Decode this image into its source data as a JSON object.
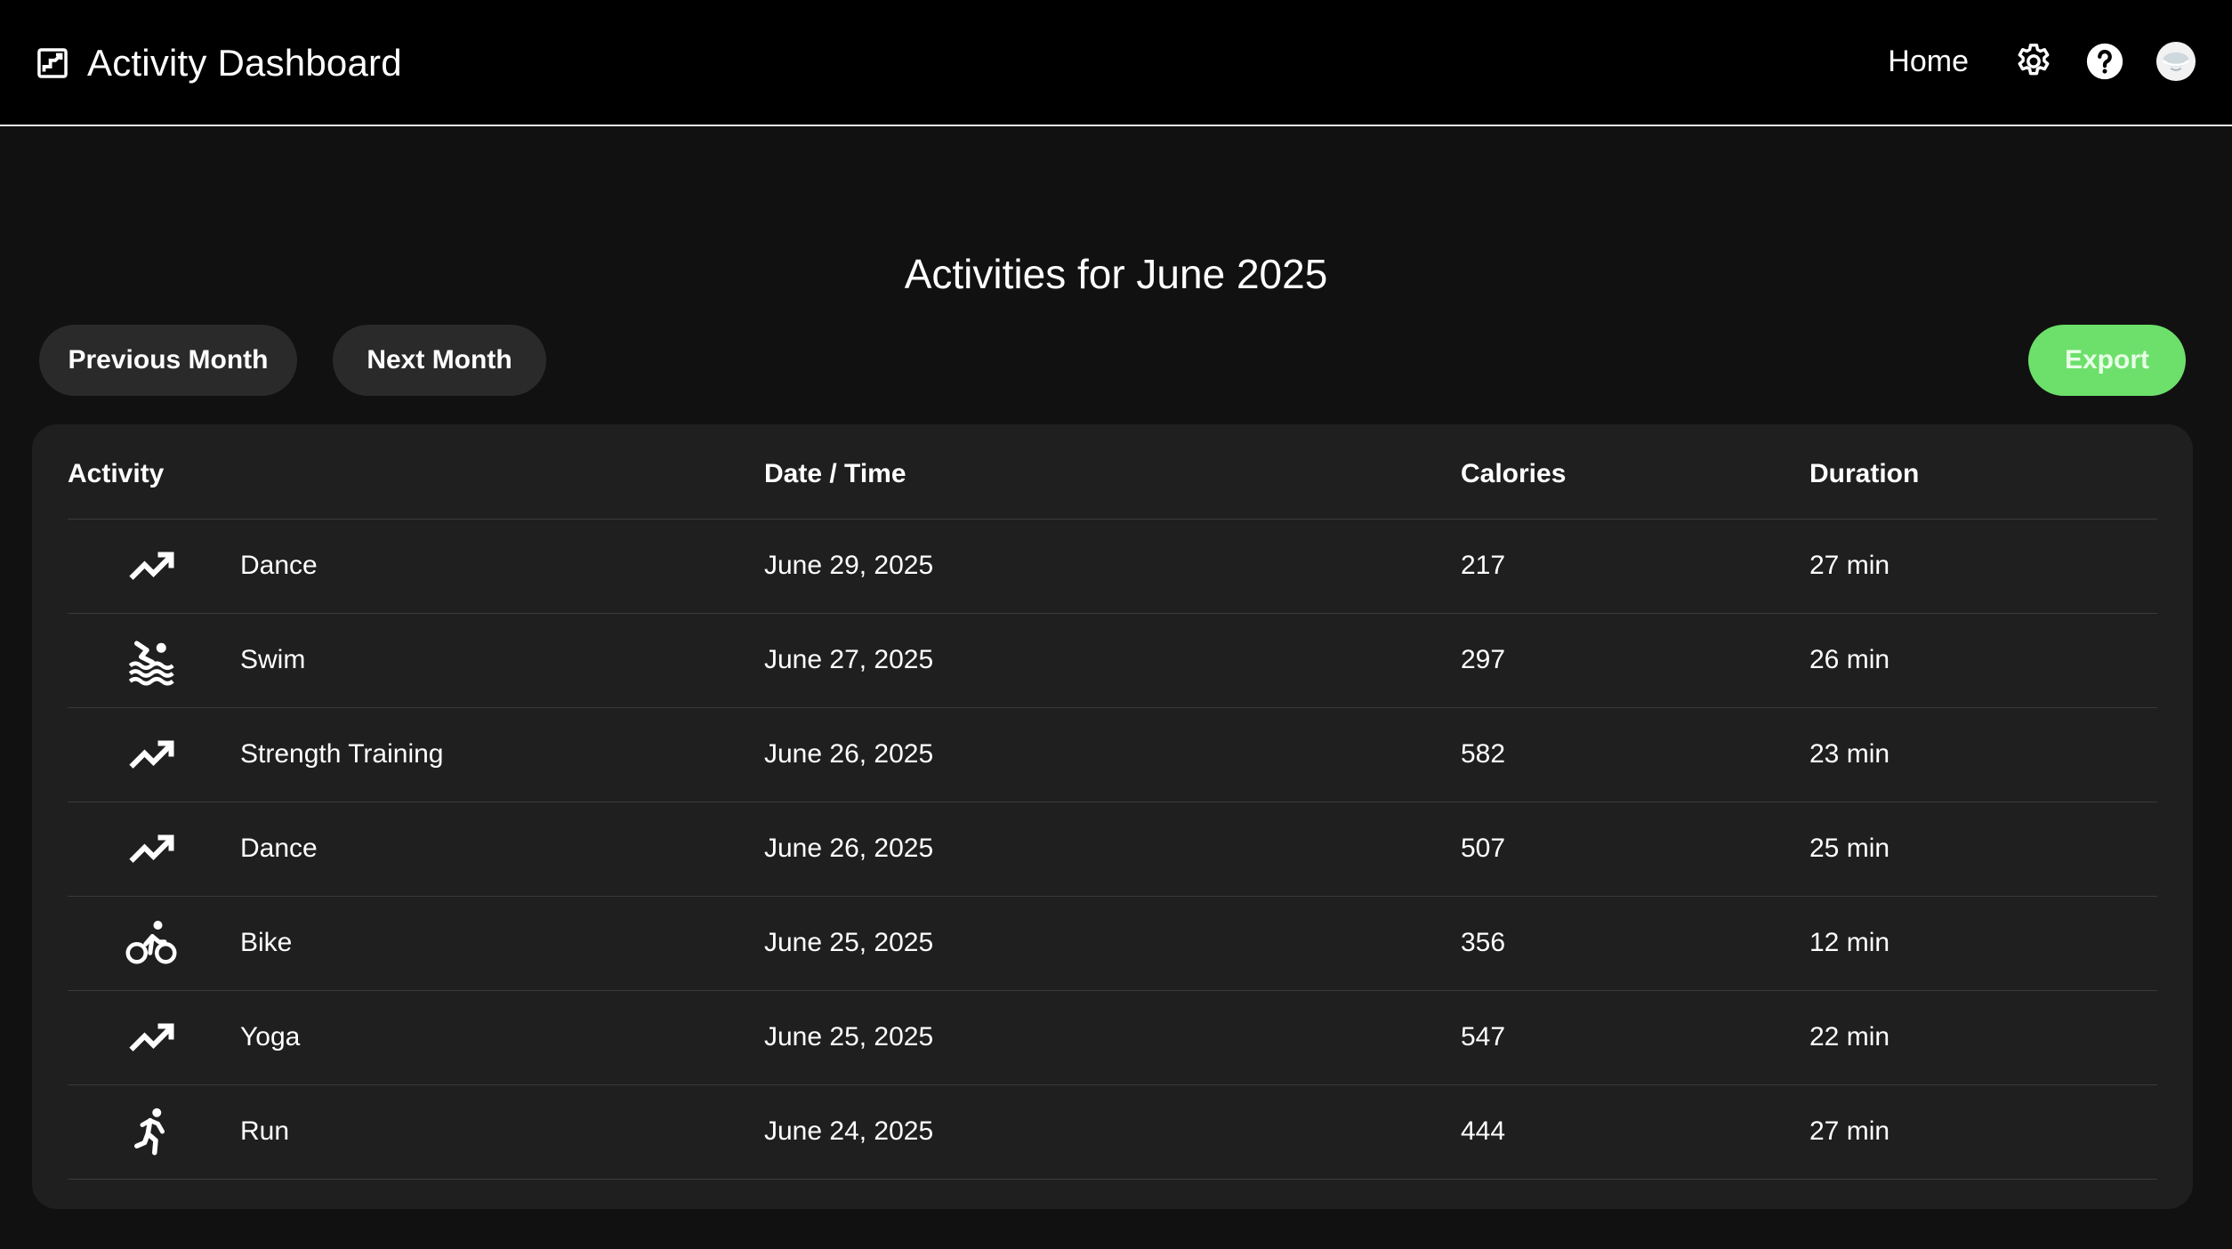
{
  "header": {
    "title": "Activity Dashboard",
    "logo_icon": "chart-box-icon",
    "nav": {
      "home_label": "Home",
      "settings_icon": "gear-icon",
      "help_icon": "help-circle-icon",
      "avatar_icon": "avatar"
    }
  },
  "page": {
    "title": "Activities for June 2025"
  },
  "toolbar": {
    "previous_label": "Previous Month",
    "next_label": "Next Month",
    "export_label": "Export"
  },
  "colors": {
    "background": "#111111",
    "header_background": "#000000",
    "card_background": "#1f1f1f",
    "button_background": "#2a2a2a",
    "accent_green": "#6ce06a"
  },
  "table": {
    "columns": [
      "Activity",
      "Date / Time",
      "Calories",
      "Duration"
    ],
    "rows": [
      {
        "icon": "trending-up-icon",
        "activity": "Dance",
        "date": "June 29, 2025",
        "calories": "217",
        "duration": "27 min"
      },
      {
        "icon": "swim-icon",
        "activity": "Swim",
        "date": "June 27, 2025",
        "calories": "297",
        "duration": "26 min"
      },
      {
        "icon": "trending-up-icon",
        "activity": "Strength Training",
        "date": "June 26, 2025",
        "calories": "582",
        "duration": "23 min"
      },
      {
        "icon": "trending-up-icon",
        "activity": "Dance",
        "date": "June 26, 2025",
        "calories": "507",
        "duration": "25 min"
      },
      {
        "icon": "bike-icon",
        "activity": "Bike",
        "date": "June 25, 2025",
        "calories": "356",
        "duration": "12 min"
      },
      {
        "icon": "trending-up-icon",
        "activity": "Yoga",
        "date": "June 25, 2025",
        "calories": "547",
        "duration": "22 min"
      },
      {
        "icon": "run-icon",
        "activity": "Run",
        "date": "June 24, 2025",
        "calories": "444",
        "duration": "27 min"
      }
    ]
  }
}
